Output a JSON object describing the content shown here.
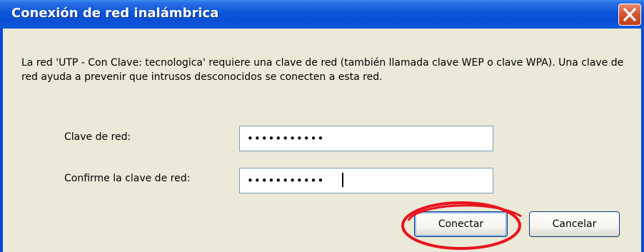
{
  "window": {
    "title": "Conexión de red inalámbrica",
    "close_icon": "close-icon"
  },
  "message": "La red 'UTP - Con Clave: tecnologica' requiere una clave de red (también llamada clave WEP o clave WPA). Una clave de red ayuda a prevenir que intrusos desconocidos se conecten a esta red.",
  "fields": {
    "network_key": {
      "label": "Clave de red:",
      "value": "•••••••••••"
    },
    "confirm_key": {
      "label": "Confirme la clave de red:",
      "value": "•••••••••••"
    }
  },
  "buttons": {
    "connect": "Conectar",
    "cancel": "Cancelar"
  },
  "colors": {
    "titlebar": "#0a4fd3",
    "dialog_background": "#ece9d8",
    "highlight_circle": "#e8141c"
  }
}
